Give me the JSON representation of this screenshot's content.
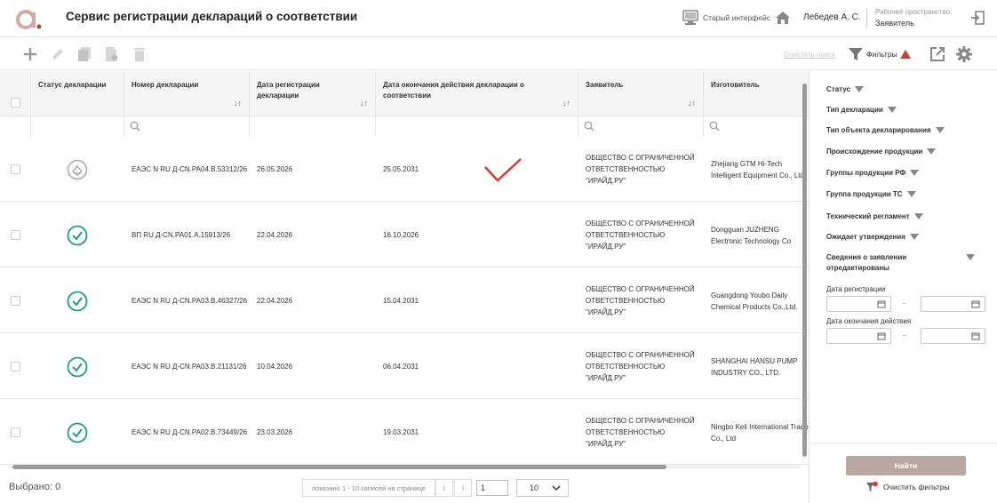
{
  "header": {
    "app_title": "Сервис регистрации деклараций о соответствии",
    "old_interface": "Старый интерфейс",
    "user_name": "Лебедев А. С.",
    "workspace_label": "Рабочее пространство:",
    "workspace_value": "Заявитель"
  },
  "toolbar": {
    "clear_search": "Очистить поиск",
    "filters": "Фильтры"
  },
  "table": {
    "columns": [
      "Статус декларации",
      "Номер декларации",
      "Дата регистрации декларации",
      "Дата окончания действия декларации о соответствии",
      "Заявитель",
      "Изготовитель"
    ],
    "rows": [
      {
        "status": "archived",
        "number": "ЕАЭС N RU Д-CN.РА04.В.53312/26",
        "reg_date": "26.05.2026",
        "end_date": "25.05.2031",
        "applicant": "ОБЩЕСТВО С ОГРАНИЧЕННОЙ ОТВЕТСТВЕННОСТЬЮ \"ИРАЙД.РУ\"",
        "manufacturer": "Zhejiang GTM Hi-Tech Intelligent Equipment Co., Ltd."
      },
      {
        "status": "valid",
        "number": "ВП RU Д-CN.РА01.А.15913/26",
        "reg_date": "22.04.2026",
        "end_date": "16.10.2026",
        "applicant": "ОБЩЕСТВО С ОГРАНИЧЕННОЙ ОТВЕТСТВЕННОСТЬЮ \"ИРАЙД.РУ\"",
        "manufacturer": "Dongguan JUZHENG Electronic Technology Co"
      },
      {
        "status": "valid",
        "number": "ЕАЭС N RU Д-CN.РА03.В.46327/26",
        "reg_date": "22.04.2026",
        "end_date": "15.04.2031",
        "applicant": "ОБЩЕСТВО С ОГРАНИЧЕННОЙ ОТВЕТСТВЕННОСТЬЮ \"ИРАЙД.РУ\"",
        "manufacturer": "Guangdong Youbo Daily Chemical Products Co.,Ltd."
      },
      {
        "status": "valid",
        "number": "ЕАЭС N RU Д-CN.РА03.В.21131/26",
        "reg_date": "10.04.2026",
        "end_date": "06.04.2031",
        "applicant": "ОБЩЕСТВО С ОГРАНИЧЕННОЙ ОТВЕТСТВЕННОСТЬЮ \"ИРАЙД.РУ\"",
        "manufacturer": "SHANGHAI HANSU PUMP INDUSTRY CO., LTD."
      },
      {
        "status": "valid",
        "number": "ЕАЭС N RU Д-CN.РА02.В.73449/26",
        "reg_date": "23.03.2026",
        "end_date": "19.03.2031",
        "applicant": "ОБЩЕСТВО С ОГРАНИЧЕННОЙ ОТВЕТСТВЕННОСТЬЮ \"ИРАЙД.РУ\"",
        "manufacturer": "Ningbo Keli International Trade Co., Ltd"
      }
    ]
  },
  "footer": {
    "selected": "Выбрано: 0",
    "pager_info": "показано 1 - 10 записей на странице",
    "page": "1",
    "page_size": "10"
  },
  "filters_panel": {
    "items": [
      "Статус",
      "Тип декларации",
      "Тип объекта декларирования",
      "Происхождение продукции",
      "Группы продукции РФ",
      "Группа продукции ТС",
      "Технический регламент",
      "Ожидает утверждения",
      "Сведения о заявлении отредактированы"
    ],
    "reg_date_label": "Дата регистрации",
    "end_date_label": "Дата окончания действия",
    "find": "Найти",
    "clear_filters": "Очистить фильтры"
  },
  "colors": {
    "accent": "#c0392b",
    "status_valid": "#1f9e77",
    "find_button": "#b9a7a1"
  }
}
